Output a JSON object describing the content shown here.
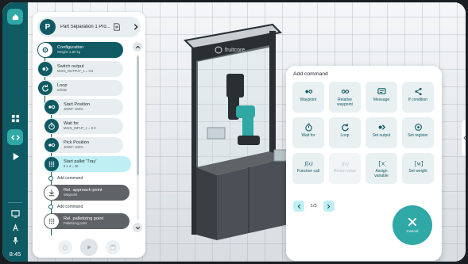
{
  "rail": {
    "time": "8:45",
    "items": [
      {
        "icon": "home-icon"
      },
      {
        "icon": "layout-icon"
      },
      {
        "icon": "code-icon"
      },
      {
        "icon": "play-icon"
      },
      {
        "icon": "monitor-icon"
      },
      {
        "icon": "text-icon"
      },
      {
        "icon": "microphone-icon"
      }
    ]
  },
  "program": {
    "avatar_letter": "P",
    "title": "Part Separation 1 Pro...",
    "nodes": [
      {
        "title": "Configuration",
        "sub": "Weight: 2.80 kg",
        "icon": "gear-icon",
        "style": "dark"
      },
      {
        "title": "Switch output",
        "sub": "MAIN_OUTPUT_1 = 0.0",
        "icon": "output-icon",
        "style": "light"
      },
      {
        "title": "Loop",
        "sub": "Infinite",
        "icon": "loop-icon",
        "style": "light"
      },
      {
        "title": "Start Position",
        "sub": "JOINT: 100%",
        "icon": "waypoint-icon",
        "style": "light"
      },
      {
        "title": "Wait for",
        "sub": "MAIN_INPUT_1 = 0.0",
        "icon": "timer-icon",
        "style": "light"
      },
      {
        "title": "Pick Position",
        "sub": "JOINT: 100%",
        "icon": "waypoint-icon",
        "style": "light"
      },
      {
        "title": "Start pallet 'Tray'",
        "sub": "5 x 4 = 20",
        "icon": "grid-icon",
        "style": "highlight"
      },
      {
        "title": "Rel. approach point",
        "sub": "Waypoint",
        "icon": "download-icon",
        "style": "gray"
      },
      {
        "title": "Rel. palletizing point",
        "sub": "Palletizing point",
        "icon": "grid-icon",
        "style": "gray"
      }
    ],
    "add_command": "Add command"
  },
  "dialog": {
    "title": "Add command",
    "tiles": [
      {
        "label": "Waypoint",
        "icon": "waypoint-icon",
        "enabled": true
      },
      {
        "label": "Relative\nwaypoint",
        "icon": "relative-waypoint-icon",
        "enabled": true
      },
      {
        "label": "Message",
        "icon": "message-icon",
        "enabled": true
      },
      {
        "label": "If condition",
        "icon": "branch-icon",
        "enabled": true
      },
      {
        "label": "Wait for",
        "icon": "timer-icon",
        "enabled": true
      },
      {
        "label": "Loop",
        "icon": "loop-icon",
        "enabled": true
      },
      {
        "label": "Set output",
        "icon": "output-icon",
        "enabled": true
      },
      {
        "label": "Set register",
        "icon": "register-icon",
        "enabled": true
      },
      {
        "label": "Function call",
        "icon": "function-icon",
        "enabled": true
      },
      {
        "label": "Return value",
        "icon": "return-icon",
        "enabled": false
      },
      {
        "label": "Assign\nvariable",
        "icon": "variable-icon",
        "enabled": true
      },
      {
        "label": "Set weight",
        "icon": "weight-icon",
        "enabled": true
      }
    ],
    "page": "1/3",
    "cancel_label": "Cancel"
  },
  "machine": {
    "brand": "fruitcore robotics"
  },
  "colors": {
    "primary": "#0f5a63",
    "accent": "#2fa8a6",
    "highlight": "#bfeff3"
  }
}
